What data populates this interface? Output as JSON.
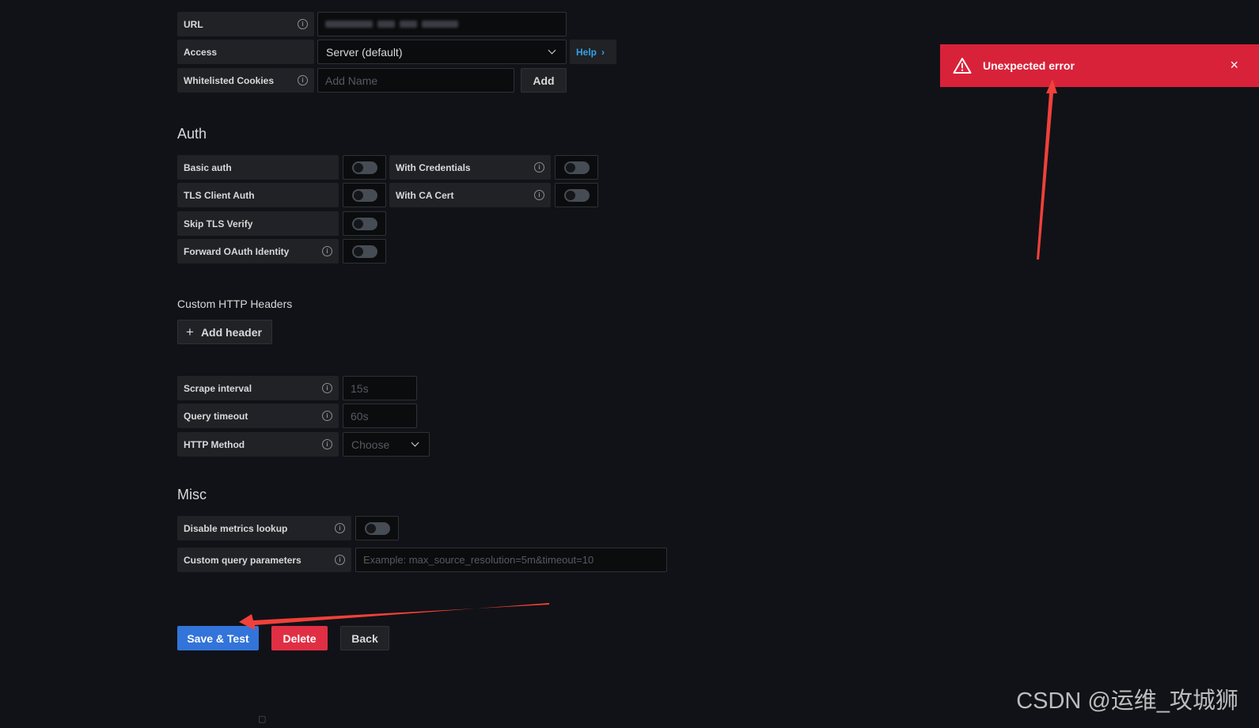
{
  "http": {
    "url_label": "URL",
    "access_label": "Access",
    "access_value": "Server (default)",
    "help_label": "Help",
    "cookies_label": "Whitelisted Cookies",
    "cookies_placeholder": "Add Name",
    "add_label": "Add"
  },
  "auth": {
    "title": "Auth",
    "basic_auth": "Basic auth",
    "with_credentials": "With Credentials",
    "tls_client_auth": "TLS Client Auth",
    "with_ca_cert": "With CA Cert",
    "skip_tls_verify": "Skip TLS Verify",
    "forward_oauth": "Forward OAuth Identity"
  },
  "headers": {
    "title": "Custom HTTP Headers",
    "add_header": "Add header"
  },
  "prometheus": {
    "scrape_interval_label": "Scrape interval",
    "scrape_interval_placeholder": "15s",
    "query_timeout_label": "Query timeout",
    "query_timeout_placeholder": "60s",
    "http_method_label": "HTTP Method",
    "http_method_placeholder": "Choose"
  },
  "misc": {
    "title": "Misc",
    "disable_metrics_label": "Disable metrics lookup",
    "custom_query_label": "Custom query parameters",
    "custom_query_placeholder": "Example: max_source_resolution=5m&timeout=10"
  },
  "actions": {
    "save_test": "Save & Test",
    "delete": "Delete",
    "back": "Back"
  },
  "toast": {
    "message": "Unexpected error",
    "close_glyph": "×"
  },
  "watermark": "CSDN @运维_攻城狮",
  "icons": {
    "info": "info-circle-icon",
    "warning": "warning-triangle-icon",
    "close": "close-icon",
    "plus": "plus-icon",
    "chevron_down": "chevron-down-icon",
    "chevron_right": "chevron-right-icon"
  },
  "colors": {
    "background": "#111217",
    "primary": "#3274d9",
    "danger": "#e02f44",
    "toast": "#d8223a",
    "link": "#33a2e5"
  }
}
